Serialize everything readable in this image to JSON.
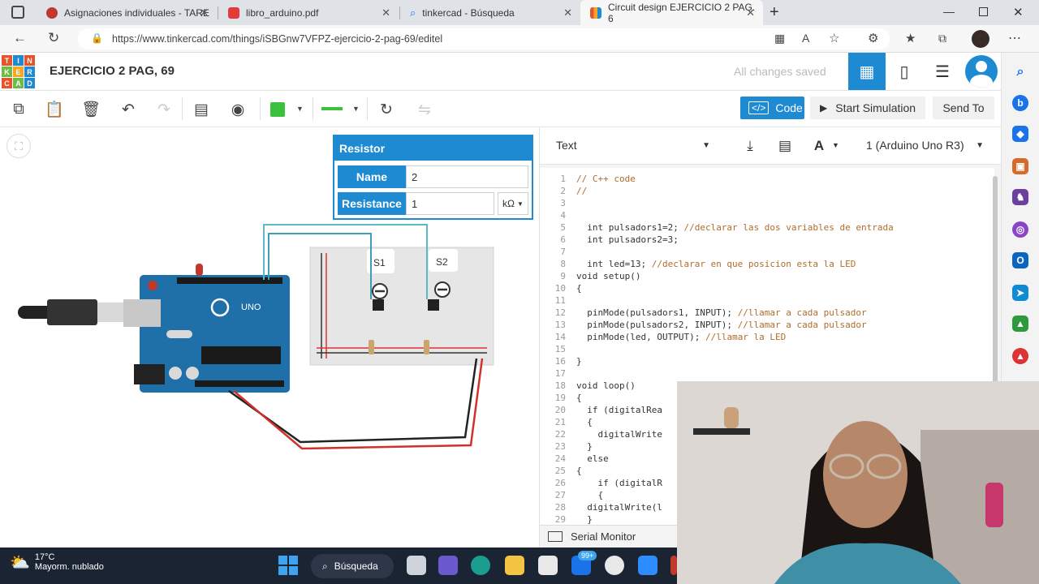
{
  "browser": {
    "tabs": [
      {
        "label": "Asignaciones individuales - TARE",
        "icon": "account-icon",
        "color": "#c0392b"
      },
      {
        "label": "libro_arduino.pdf",
        "icon": "pdf-icon",
        "color": "#e23b3b"
      },
      {
        "label": "tinkercad - Búsqueda",
        "icon": "search-icon",
        "color": "#1a73e8"
      },
      {
        "label": "Circuit design EJERCICIO 2 PAG. 6",
        "icon": "tinkercad-icon",
        "color": "#e8542a"
      }
    ],
    "new_tab_label": "+",
    "url": "https://www.tinkercad.com/things/iSBGnw7VFPZ-ejercicio-2-pag-69/editel"
  },
  "app": {
    "logo_letters": [
      "T",
      "I",
      "N",
      "K",
      "E",
      "R",
      "C",
      "A",
      "D"
    ],
    "project_title": "EJERCICIO 2 PAG, 69",
    "save_status": "All changes saved"
  },
  "toolbar": {
    "code_label": "Code",
    "simulate_label": "Start Simulation",
    "send_label": "Send To"
  },
  "inspector": {
    "title": "Resistor",
    "name_label": "Name",
    "name_value": "2",
    "resistance_label": "Resistance",
    "resistance_value": "1",
    "unit_value": "kΩ"
  },
  "circuit": {
    "board_label": "UNO",
    "switch_labels": [
      "S1",
      "S2"
    ]
  },
  "code_panel": {
    "mode": "Text",
    "device": "1 (Arduino Uno R3)",
    "lines": [
      {
        "n": "1",
        "code": "// C++ code",
        "comment": true
      },
      {
        "n": "2",
        "code": "//",
        "comment": true
      },
      {
        "n": "3",
        "code": ""
      },
      {
        "n": "4",
        "code": ""
      },
      {
        "n": "5",
        "code": "  int pulsadors1=2; ",
        "tail": "//declarar las dos variables de entrada"
      },
      {
        "n": "6",
        "code": "  int pulsadors2=3;"
      },
      {
        "n": "7",
        "code": ""
      },
      {
        "n": "8",
        "code": "  int led=13; ",
        "tail": "//declarar en que posicion esta la LED"
      },
      {
        "n": "9",
        "code": "void setup()"
      },
      {
        "n": "10",
        "code": "{"
      },
      {
        "n": "11",
        "code": ""
      },
      {
        "n": "12",
        "code": "  pinMode(pulsadors1, INPUT); ",
        "tail": "//llamar a cada pulsador"
      },
      {
        "n": "13",
        "code": "  pinMode(pulsadors2, INPUT); ",
        "tail": "//llamar a cada pulsador"
      },
      {
        "n": "14",
        "code": "  pinMode(led, OUTPUT); ",
        "tail": "//llamar la LED"
      },
      {
        "n": "15",
        "code": ""
      },
      {
        "n": "16",
        "code": "}"
      },
      {
        "n": "17",
        "code": ""
      },
      {
        "n": "18",
        "code": "void loop()"
      },
      {
        "n": "19",
        "code": "{"
      },
      {
        "n": "20",
        "code": "  if (digitalRea"
      },
      {
        "n": "21",
        "code": "  {"
      },
      {
        "n": "22",
        "code": "    digitalWrite"
      },
      {
        "n": "23",
        "code": "  }"
      },
      {
        "n": "24",
        "code": "  else"
      },
      {
        "n": "25",
        "code": "{"
      },
      {
        "n": "26",
        "code": "    if (digitalR"
      },
      {
        "n": "27",
        "code": "    {"
      },
      {
        "n": "28",
        "code": "  digitalWrite(l"
      },
      {
        "n": "29",
        "code": "  }"
      }
    ],
    "serial_monitor_label": "Serial Monitor"
  },
  "taskbar": {
    "temperature": "17°C",
    "weather_text": "Mayorm. nublado",
    "search_label": "Búsqueda",
    "badge": "99+"
  },
  "colors": {
    "accent": "#1e8ad1",
    "comment": "#b06d2c",
    "taskbar": "#1b2433"
  }
}
